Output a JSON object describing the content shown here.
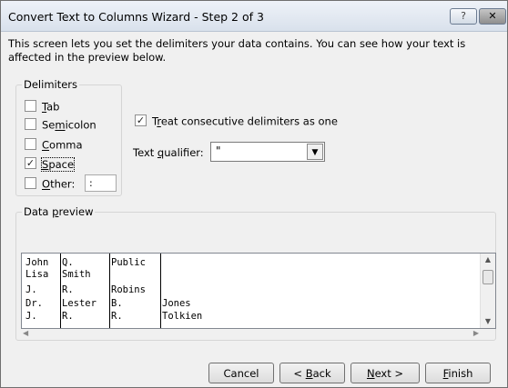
{
  "window": {
    "title": "Convert Text to Columns Wizard - Step 2 of 3",
    "help_label": "?",
    "close_label": "✕"
  },
  "description": "This screen lets you set the delimiters your data contains.  You can see how your text is affected in the preview below.",
  "delimiters": {
    "group_label": "Delimiters",
    "tab": {
      "label": "Tab",
      "checked": false
    },
    "semicolon": {
      "label": "Semicolon",
      "checked": false
    },
    "comma": {
      "label": "Comma",
      "checked": false
    },
    "space": {
      "label": "Space",
      "checked": true
    },
    "other": {
      "label": "Other:",
      "checked": false,
      "value": ":"
    }
  },
  "consecutive": {
    "label": "Treat consecutive delimiters as one",
    "checked": true
  },
  "text_qualifier": {
    "label": "Text qualifier:",
    "value": "\""
  },
  "preview": {
    "group_label": "Data preview",
    "rows": [
      [
        "John",
        "Q.",
        "Public",
        ""
      ],
      [
        "Lisa",
        "Smith",
        "",
        ""
      ],
      [
        "J.",
        "R.",
        "Robins",
        ""
      ],
      [
        "Dr.",
        "Lester",
        "B.",
        "Jones"
      ],
      [
        "J.",
        "R.",
        "R.",
        "Tolkien"
      ]
    ]
  },
  "buttons": {
    "cancel": "Cancel",
    "back": "< Back",
    "next": "Next >",
    "finish": "Finish"
  }
}
